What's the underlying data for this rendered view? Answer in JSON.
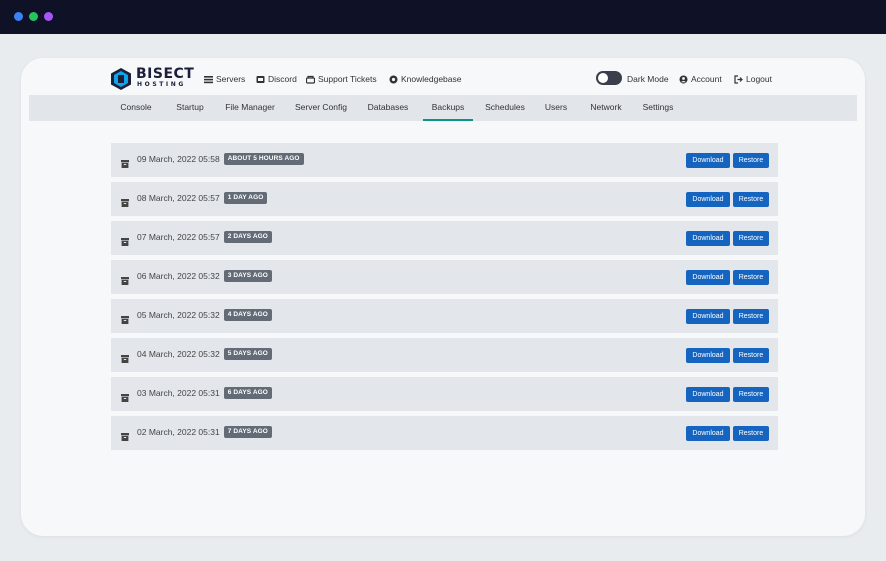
{
  "window": {
    "dots": [
      {
        "color": "#3b82f6",
        "name": "window-dot-blue"
      },
      {
        "color": "#22c55e",
        "name": "window-dot-green"
      },
      {
        "color": "#a855f7",
        "name": "window-dot-purple"
      }
    ]
  },
  "brand": {
    "name": "BISECT",
    "sub": "HOSTING",
    "accent": "#0ea5e9"
  },
  "header": {
    "links": [
      {
        "label": "Servers",
        "icon": "list-icon"
      },
      {
        "label": "Discord",
        "icon": "discord-icon"
      },
      {
        "label": "Support Tickets",
        "icon": "ticket-icon"
      },
      {
        "label": "Knowledgebase",
        "icon": "help-icon"
      }
    ],
    "dark_mode_label": "Dark Mode",
    "account_label": "Account",
    "logout_label": "Logout"
  },
  "tabs": [
    {
      "label": "Console"
    },
    {
      "label": "Startup"
    },
    {
      "label": "File Manager"
    },
    {
      "label": "Server Config"
    },
    {
      "label": "Databases"
    },
    {
      "label": "Backups",
      "active": true
    },
    {
      "label": "Schedules"
    },
    {
      "label": "Users"
    },
    {
      "label": "Network"
    },
    {
      "label": "Settings"
    }
  ],
  "backups": [
    {
      "date": "09 March, 2022 05:58",
      "age": "ABOUT 5 HOURS AGO"
    },
    {
      "date": "08 March, 2022 05:57",
      "age": "1 DAY AGO"
    },
    {
      "date": "07 March, 2022 05:57",
      "age": "2 DAYS AGO"
    },
    {
      "date": "06 March, 2022 05:32",
      "age": "3 DAYS AGO"
    },
    {
      "date": "05 March, 2022 05:32",
      "age": "4 DAYS AGO"
    },
    {
      "date": "04 March, 2022 05:32",
      "age": "5 DAYS AGO"
    },
    {
      "date": "03 March, 2022 05:31",
      "age": "6 DAYS AGO"
    },
    {
      "date": "02 March, 2022 05:31",
      "age": "7 DAYS AGO"
    }
  ],
  "actions": {
    "download_label": "Download",
    "restore_label": "Restore",
    "button_color": "#1565c0"
  }
}
